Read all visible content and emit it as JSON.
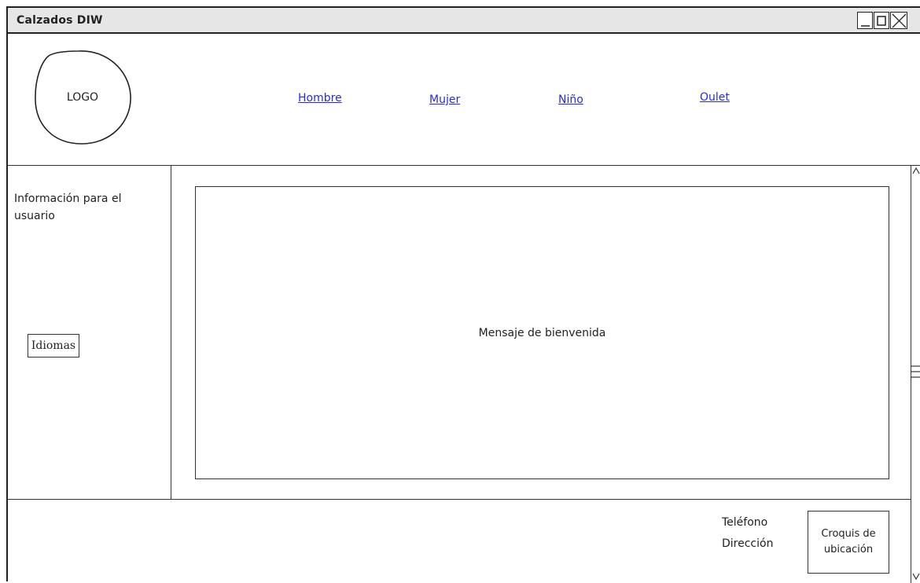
{
  "window": {
    "title": "Calzados DIW"
  },
  "header": {
    "logo_text": "LOGO",
    "nav": [
      "Hombre",
      "Mujer",
      "Niño",
      "Oulet"
    ]
  },
  "sidebar": {
    "info_text": "Información para el usuario",
    "language_button": "Idiomas"
  },
  "main": {
    "welcome_message": "Mensaje de bienvenida"
  },
  "footer": {
    "phone_label": "Teléfono",
    "address_label": "Dirección",
    "map_label": "Croquis de ubicación"
  },
  "colors": {
    "link": "#2a2ae0",
    "titlebar": "#e6e6e6",
    "border": "#222222"
  },
  "icons": [
    "minimize-icon",
    "maximize-icon",
    "close-icon",
    "scroll-up-icon",
    "scroll-down-icon"
  ]
}
